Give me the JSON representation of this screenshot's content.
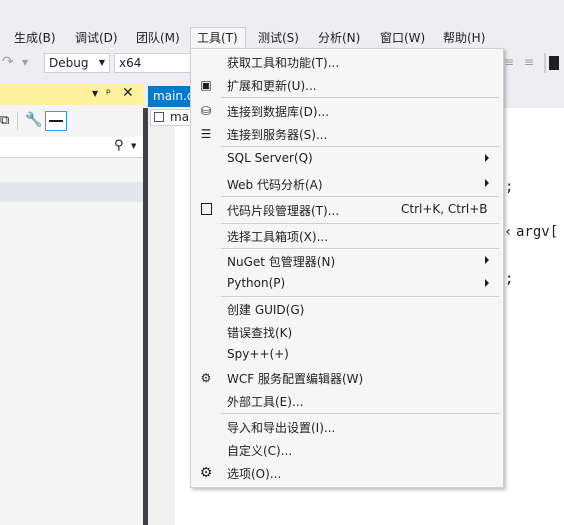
{
  "menubar": {
    "items": [
      {
        "label": "生成(B)"
      },
      {
        "label": "调试(D)"
      },
      {
        "label": "团队(M)"
      },
      {
        "label": "工具(T)"
      },
      {
        "label": "测试(S)"
      },
      {
        "label": "分析(N)"
      },
      {
        "label": "窗口(W)"
      },
      {
        "label": "帮助(H)"
      }
    ]
  },
  "toolbar": {
    "config": "Debug",
    "platform": "x64"
  },
  "editor": {
    "tab_label": "main.c",
    "subtab_label": "ma",
    "code_fragments": [
      ";",
      "argv[",
      ";"
    ]
  },
  "tools_menu": {
    "items": [
      {
        "label": "获取工具和功能(T)...",
        "icon": "none"
      },
      {
        "label": "扩展和更新(U)...",
        "icon": "extensions-icon"
      },
      {
        "label": "连接到数据库(D)...",
        "icon": "database-connect-icon"
      },
      {
        "label": "连接到服务器(S)...",
        "icon": "server-connect-icon"
      },
      {
        "label": "SQL Server(Q)",
        "submenu": true
      },
      {
        "label": "Web 代码分析(A)",
        "submenu": true
      },
      {
        "label": "代码片段管理器(T)...",
        "shortcut": "Ctrl+K, Ctrl+B",
        "icon": "checkbox-icon"
      },
      {
        "label": "选择工具箱项(X)..."
      },
      {
        "label": "NuGet 包管理器(N)",
        "submenu": true
      },
      {
        "label": "Python(P)",
        "submenu": true
      },
      {
        "label": "创建 GUID(G)"
      },
      {
        "label": "错误查找(K)"
      },
      {
        "label": "Spy++(+)"
      },
      {
        "label": "WCF 服务配置编辑器(W)",
        "icon": "wcf-gear-icon"
      },
      {
        "label": "外部工具(E)..."
      },
      {
        "label": "导入和导出设置(I)..."
      },
      {
        "label": "自定义(C)..."
      },
      {
        "label": "选项(O)...",
        "icon": "gear-icon"
      }
    ]
  }
}
